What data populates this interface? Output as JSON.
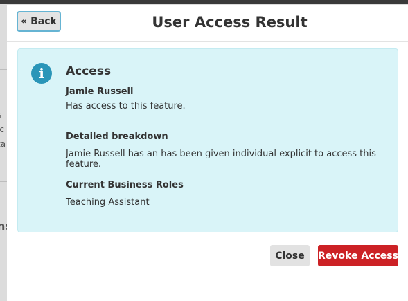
{
  "background_page": {
    "snippets": [
      "s",
      "ic",
      "ta",
      "ns"
    ]
  },
  "modal": {
    "back_label": "« Back",
    "title": "User Access Result",
    "panel": {
      "icon": "info-circle-icon",
      "heading": "Access",
      "user_name": "Jamie Russell",
      "user_access_text": "Has access to this feature.",
      "breakdown_label": "Detailed breakdown",
      "breakdown_text": "Jamie Russell has an has been given individual explicit to access this feature.",
      "roles_label": "Current Business Roles",
      "roles_value": "Teaching Assistant"
    },
    "close_label": "Close",
    "revoke_label": "Revoke Access"
  },
  "colors": {
    "panel_bg": "#d9f4f8",
    "info_icon": "#2a95b8",
    "revoke_button": "#cc2125",
    "back_button_border": "#66b4d3"
  }
}
